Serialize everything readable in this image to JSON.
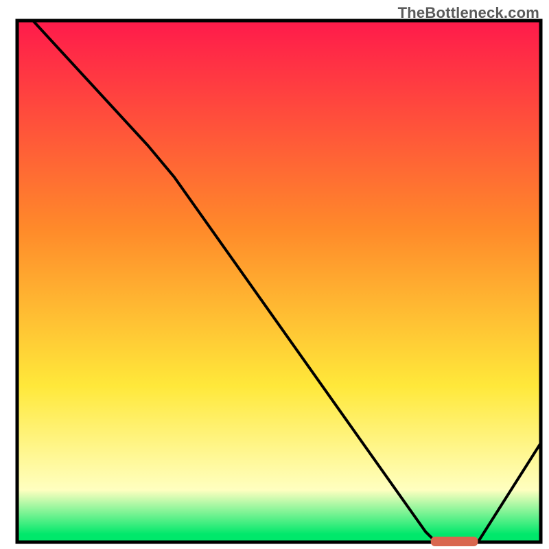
{
  "watermark": "TheBottleneck.com",
  "colors": {
    "border": "#000000",
    "curve": "#000000",
    "marker_fill": "#d9674f",
    "grad_top": "#ff1a4b",
    "grad_orange": "#ff8a2a",
    "grad_yellow": "#ffe83a",
    "grad_paleyellow": "#ffffc0",
    "grad_green": "#00e86b"
  },
  "chart_data": {
    "type": "line",
    "title": "",
    "xlabel": "",
    "ylabel": "",
    "xlim": [
      0,
      100
    ],
    "ylim": [
      0,
      100
    ],
    "curve": [
      {
        "x": 3,
        "y": 100
      },
      {
        "x": 25,
        "y": 76
      },
      {
        "x": 30,
        "y": 70
      },
      {
        "x": 78,
        "y": 2
      },
      {
        "x": 80,
        "y": 0
      },
      {
        "x": 88,
        "y": 0
      },
      {
        "x": 100,
        "y": 19
      }
    ],
    "optimum_range": {
      "x_start": 79,
      "x_end": 88,
      "y": 0
    },
    "background_gradient_stops": [
      {
        "offset": 0.0,
        "color_key": "grad_top"
      },
      {
        "offset": 0.4,
        "color_key": "grad_orange"
      },
      {
        "offset": 0.7,
        "color_key": "grad_yellow"
      },
      {
        "offset": 0.9,
        "color_key": "grad_paleyellow"
      },
      {
        "offset": 0.985,
        "color_key": "grad_green"
      }
    ]
  }
}
